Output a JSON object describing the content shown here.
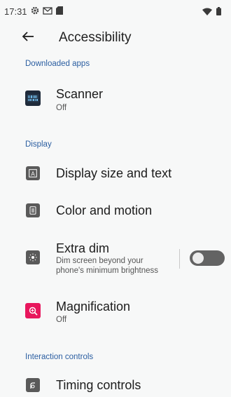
{
  "status_bar": {
    "time": "17:31",
    "icons_left": [
      "gear-icon",
      "gmail-icon",
      "sd-card-icon"
    ],
    "icons_right": [
      "wifi-icon",
      "battery-icon"
    ]
  },
  "app_bar": {
    "title": "Accessibility",
    "back_icon": "arrow-back-icon"
  },
  "sections": {
    "downloaded_apps": {
      "header": "Downloaded apps"
    },
    "display": {
      "header": "Display"
    },
    "interaction_controls": {
      "header": "Interaction controls"
    }
  },
  "items": {
    "scanner": {
      "title": "Scanner",
      "subtitle": "Off",
      "icon": "barcode-scanner-icon"
    },
    "display_size": {
      "title": "Display size and text",
      "icon": "text-size-icon"
    },
    "color_motion": {
      "title": "Color and motion",
      "icon": "color-motion-icon"
    },
    "extra_dim": {
      "title": "Extra dim",
      "subtitle_line1": "Dim screen beyond your",
      "subtitle_line2": "phone's minimum brightness",
      "icon": "brightness-dim-icon",
      "toggle_on": false
    },
    "magnification": {
      "title": "Magnification",
      "subtitle": "Off",
      "icon": "magnify-icon",
      "icon_color": "#e8175d"
    },
    "timing_controls": {
      "title": "Timing controls",
      "icon": "timer-icon"
    }
  }
}
